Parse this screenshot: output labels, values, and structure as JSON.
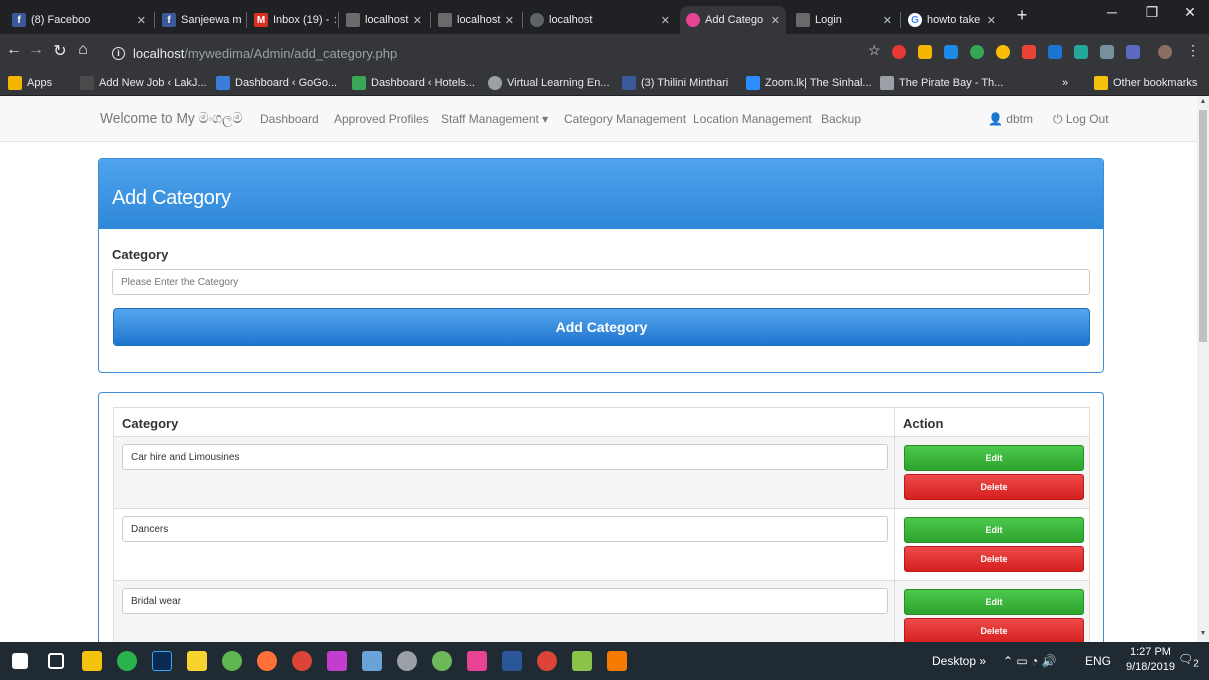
{
  "browser": {
    "tabs": [
      {
        "label": "(8) Faceboo",
        "color": "#3b5998",
        "glyph": "f"
      },
      {
        "label": "Sanjeewa m",
        "color": "#3b5998",
        "glyph": "f"
      },
      {
        "label": "Inbox (19) -",
        "color": "#d93025",
        "glyph": "M"
      },
      {
        "label": "localhost",
        "color": "#6b6b6b",
        "glyph": ""
      },
      {
        "label": "localhost",
        "color": "#6b6b6b",
        "glyph": ""
      },
      {
        "label": "localhost",
        "color": "#5f6368",
        "glyph": "◎"
      },
      {
        "label": "Add Catego",
        "color": "#e84393",
        "glyph": ""
      },
      {
        "label": "Login",
        "color": "#6b6b6b",
        "glyph": ""
      },
      {
        "label": "howto take",
        "color": "#4285f4",
        "glyph": "G"
      }
    ],
    "new_tab": "+",
    "url_host": "localhost",
    "url_path": "/mywedima/Admin/add_category.php",
    "bookmarks": [
      {
        "label": "Apps",
        "color": "#f4b400"
      },
      {
        "label": "Add New Job ‹ LakJ...",
        "color": "#4a4a4a"
      },
      {
        "label": "Dashboard ‹ GoGo...",
        "color": "#3c7dd9"
      },
      {
        "label": "Dashboard ‹ Hotels...",
        "color": "#3aa757"
      },
      {
        "label": "Virtual Learning En...",
        "color": "#9aa0a6"
      },
      {
        "label": "(3) Thilini Minthari",
        "color": "#3b5998"
      },
      {
        "label": "Zoom.lk| The Sinhal...",
        "color": "#2d8cff"
      },
      {
        "label": "The Pirate Bay - Th...",
        "color": "#9aa0a6"
      }
    ],
    "more": "»",
    "other_bookmarks": "Other bookmarks"
  },
  "navbar": {
    "brand": "Welcome to My මංගලම",
    "links": [
      "Dashboard",
      "Approved Profiles",
      "Staff Management ▾",
      "Category Management",
      "Location Management",
      "Backup"
    ],
    "user": "dbtm",
    "logout": "Log Out"
  },
  "form": {
    "title": "Add Category",
    "label": "Category",
    "placeholder": "Please Enter the Category",
    "submit": "Add Category"
  },
  "table": {
    "headers": [
      "Category",
      "Action"
    ],
    "rows": [
      {
        "category": "Car hire and Limousines",
        "edit": "Edit",
        "delete": "Delete"
      },
      {
        "category": "Dancers",
        "edit": "Edit",
        "delete": "Delete"
      },
      {
        "category": "Bridal wear",
        "edit": "Edit",
        "delete": "Delete"
      }
    ]
  },
  "taskbar": {
    "desktop": "Desktop",
    "lang": "ENG",
    "time": "1:27 PM",
    "date": "9/18/2019",
    "notif": "2"
  }
}
